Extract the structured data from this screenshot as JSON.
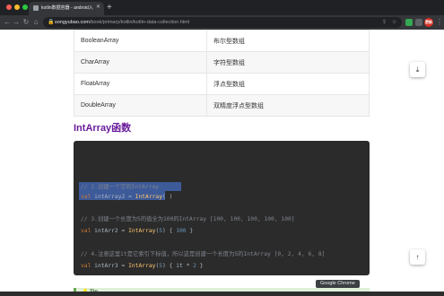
{
  "browser": {
    "tab": {
      "title": "kotlin数据容器 - android入门到精通",
      "close": "✕"
    },
    "new_tab": "+",
    "nav": {
      "back": "←",
      "forward": "→",
      "reload": "↻",
      "home": "⌂"
    },
    "url": {
      "host": "songyubao.com",
      "path": "/book/primary/kotlin/kotlin-data-collection.html"
    },
    "omni_icons": {
      "bookmark": "☆"
    },
    "avatar_text": "更新",
    "menu": "⋮",
    "tooltip": "Google Chrome"
  },
  "table": {
    "rows": [
      {
        "type": "BooleanArray",
        "desc": "布尔型数组"
      },
      {
        "type": "CharArray",
        "desc": "字符型数组"
      },
      {
        "type": "FloatArray",
        "desc": "浮点型数组"
      },
      {
        "type": "DoubleArray",
        "desc": "双精度浮点型数组"
      }
    ]
  },
  "section": {
    "title": "IntArray函数"
  },
  "code": {
    "line1": {
      "comment": "// 2.创建一个空的IntArray",
      "selected": true
    },
    "line2": {
      "kw": "val ",
      "name": "intArray2 = ",
      "fn": "IntArray",
      "rest": "( )"
    },
    "line3": {
      "comment": "// 3.创建一个长度为5的值全为100的IntArray [100, 100, 100, 100, 100]"
    },
    "line4": {
      "kw": "val ",
      "name": "intArr2 = ",
      "fn": "IntArray",
      "p1": "(",
      "n1": "5",
      "p2": ") { ",
      "n2": "100",
      "p3": " }"
    },
    "line5": {
      "comment": "// 4.注意这里it是它索引下标值，所以这是创建一个长度为5的IntArray [0, 2, 4, 6, 8]"
    },
    "line6": {
      "kw": "val ",
      "name": "intArr3 = ",
      "fn": "IntArray",
      "p1": "(",
      "n1": "5",
      "p2": ") { it * ",
      "n2": "2",
      "p3": " }"
    }
  },
  "tip": {
    "label": "💡 Tip"
  },
  "float_buttons": {
    "download": "⤓",
    "top": "↑"
  }
}
